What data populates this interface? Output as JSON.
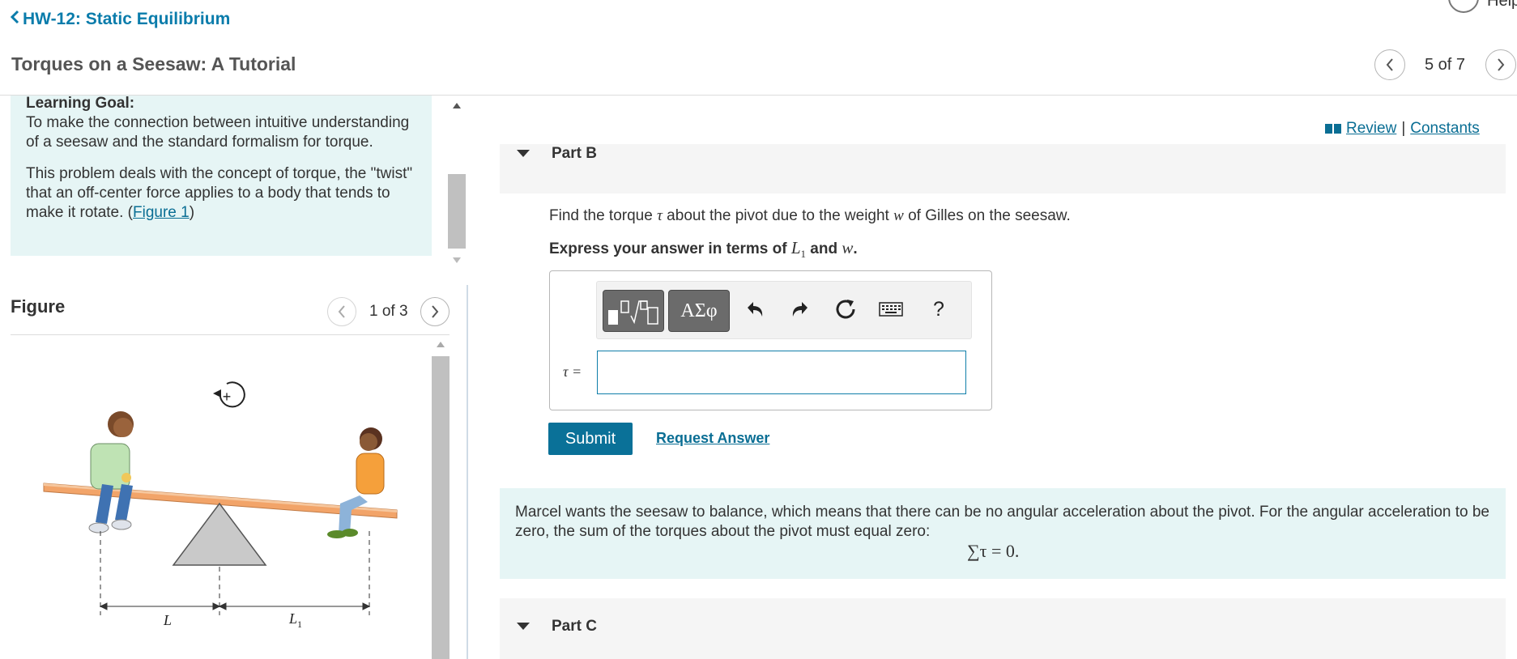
{
  "header": {
    "back_label": "HW-12: Static Equilibrium",
    "title": "Torques on a Seesaw: A Tutorial",
    "help_label": "Help",
    "page_indicator": "5 of 7"
  },
  "intro": {
    "goal_heading": "Learning Goal:",
    "goal_text": "To make the connection between intuitive understanding of a seesaw and the standard formalism for torque.",
    "body_text": "This problem deals with the concept of torque, the \"twist\" that an off-center force applies to a body that tends to make it rotate. (",
    "figure_link": "Figure 1",
    "body_close": ")"
  },
  "figure": {
    "title": "Figure",
    "page_indicator": "1 of 3",
    "label_L": "L",
    "label_L1": "L",
    "label_L1_sub": "1",
    "rotation_sign": "+"
  },
  "links": {
    "review": "Review",
    "separator": "|",
    "constants": "Constants"
  },
  "part_b": {
    "label": "Part B",
    "question_pre": "Find the torque ",
    "tau": "τ",
    "question_mid": " about the pivot due to the weight ",
    "w": "w",
    "question_post": " of Gilles on the seesaw.",
    "express_pre": "Express your answer in terms of ",
    "L": "L",
    "L_sub": "1",
    "express_and": " and ",
    "express_end": ".",
    "input_label": "τ =",
    "input_value": "",
    "toolbar": {
      "greek": "ΑΣφ",
      "help": "?"
    },
    "submit_label": "Submit",
    "request_label": "Request Answer"
  },
  "hint": {
    "text": "Marcel wants the seesaw to balance, which means that there can be no angular acceleration about the pivot. For the angular acceleration to be zero, the sum of the torques about the pivot must equal zero:",
    "equation": "∑τ = 0."
  },
  "part_c": {
    "label": "Part C"
  },
  "colors": {
    "accent": "#0a7198",
    "info_bg": "#e6f5f5",
    "part_bg": "#f5f5f5"
  }
}
